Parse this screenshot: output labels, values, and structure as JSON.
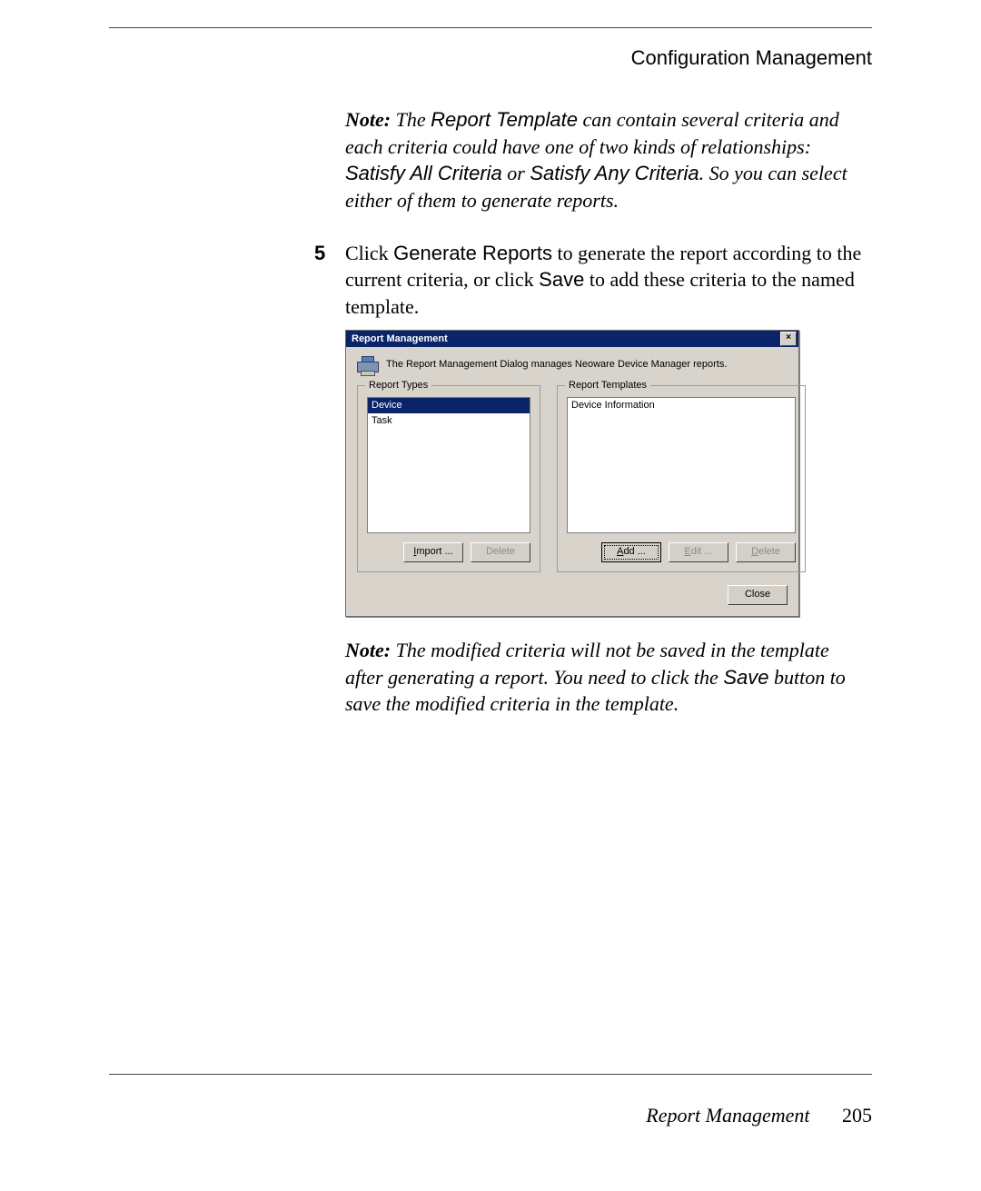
{
  "runningHead": "Configuration Management",
  "note1": {
    "label": "Note:",
    "s1": " The ",
    "rt": "Report Template",
    "s2": " can contain several criteria and each criteria could have one of two kinds of relationships: ",
    "sac": "Satisfy All Criteria",
    "s3": " or ",
    "say": "Satisfy Any Criteria",
    "s4": ". So you can select either of them to generate reports."
  },
  "step5": {
    "num": "5",
    "s1": "Click ",
    "gr": "Generate Reports",
    "s2": " to generate the report according to the current criteria, or click ",
    "sv": "Save",
    "s3": " to add these criteria to the named template."
  },
  "dialog": {
    "title": "Report Management",
    "close": "×",
    "desc": "The Report Management Dialog manages Neoware Device Manager reports.",
    "typesLegend": "Report Types",
    "templatesLegend": "Report Templates",
    "typeItems": [
      "Device",
      "Task"
    ],
    "templateItems": [
      "Device Information"
    ],
    "importLabel": "Import ...",
    "importU": "I",
    "typesDelete": "Delete",
    "addLabel": "Add ...",
    "addU": "A",
    "editLabel": "Edit ...",
    "editU": "E",
    "tplDelete": "Delete",
    "tplDeleteU": "D",
    "closeBtn": "Close"
  },
  "note2": {
    "label": "Note:",
    "s1": " The modified criteria will not be saved in the template after generating a report. You need to click the ",
    "sv": "Save",
    "s2": " button to save the modified criteria in the template."
  },
  "footer": {
    "section": "Report Management",
    "page": "205"
  }
}
